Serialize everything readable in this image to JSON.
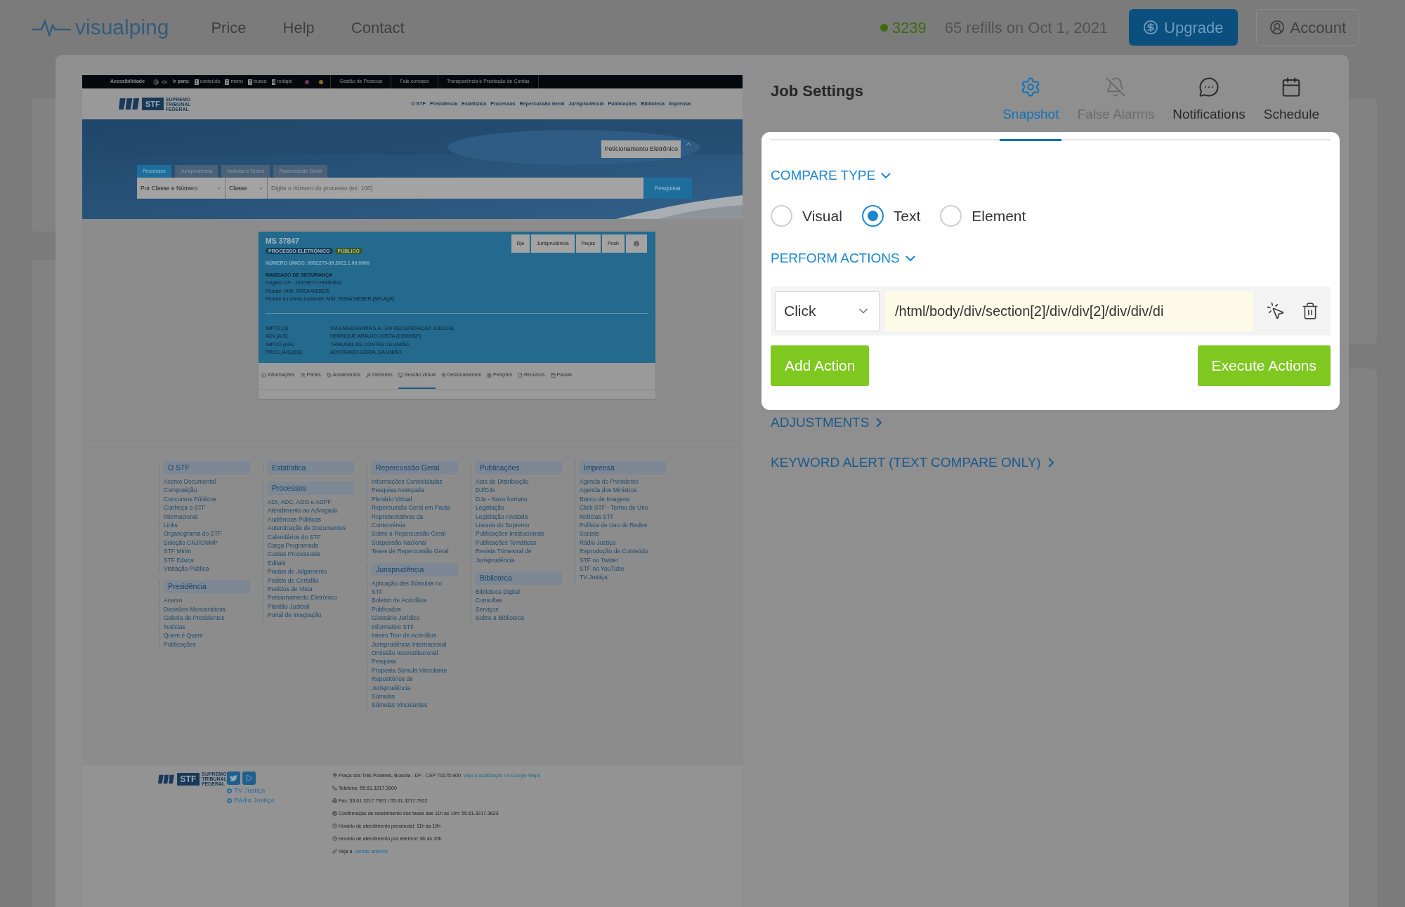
{
  "app_bar": {
    "logo": "visualping",
    "nav": [
      "Price",
      "Help",
      "Contact"
    ],
    "credits": "3239",
    "refills": "65 refills on Oct 1, 2021",
    "upgrade": "Upgrade",
    "account": "Account"
  },
  "preview": {
    "top_bar": {
      "accessibility": "Acessibilidade",
      "goto": "Ir para:",
      "shortcuts": [
        {
          "key": "1",
          "label": "conteúdo"
        },
        {
          "key": "2",
          "label": "menu"
        },
        {
          "key": "3",
          "label": "busca"
        },
        {
          "key": "4",
          "label": "rodapé"
        }
      ],
      "links": [
        "Gestão de Pessoas",
        "Fale conosco",
        "Transparência e Prestação de Contas"
      ]
    },
    "header": {
      "logo_abbr": "STF",
      "logo_name": [
        "SUPREMO",
        "TRIBUNAL",
        "FEDERAL"
      ],
      "nav": [
        "O STF",
        "Presidência",
        "Estatística",
        "Processos",
        "Repercussão Geral",
        "Jurisprudência",
        "Publicações",
        "Biblioteca",
        "Imprensa"
      ]
    },
    "hero": {
      "e_filing": "Peticionamento Eletrônico",
      "tabs": [
        {
          "label": "Processos",
          "selected": true
        },
        {
          "label": "Jurisprudência",
          "selected": false
        },
        {
          "label": "Notícias e Textos",
          "selected": false
        },
        {
          "label": "Repercussão Geral",
          "selected": false
        }
      ],
      "search": {
        "type": "Por Classe e Número",
        "class": "Classe",
        "placeholder": "Digite o número do processo (ex: 100)",
        "button": "Pesquisar"
      }
    },
    "case": {
      "number": "MS 37847",
      "badges": [
        {
          "label": "PROCESSO ELETRÔNICO",
          "color": "#123f5e"
        },
        {
          "label": "PÚBLICO",
          "color": "#3b5a12"
        }
      ],
      "actions": [
        "Dje",
        "Jurisprudência",
        "Peças",
        "Push"
      ],
      "unique_number": "NÚMERO ÚNICO: 0052279-39.2021.1.00.0000",
      "class": "MANDADO DE SEGURANÇA",
      "details": [
        "Origem: DF - DISTRITO FEDERAL",
        "Relator: MIN. ROSA WEBER",
        "Relator do último incidente: MIN. ROSA WEBER (MS-AgR)"
      ],
      "parties": [
        {
          "role": "IMPTE.(S)",
          "name": "VIA ENGENHARIA S.A - EM RECUPERAÇÃO JUDICIAL"
        },
        {
          "role": "ADV.(A/S)",
          "name": "HENRIQUE ARAUJO COSTA (21989/DF)"
        },
        {
          "role": "IMPDO.(A/S)",
          "name": "TRIBUNAL DE CONTAS DA UNIÃO"
        },
        {
          "role": "PROC.(A/S)(ES)",
          "name": "ADVOGADO-GERAL DA UNIÃO"
        }
      ],
      "tabs": [
        {
          "label": "Informações",
          "selected": false
        },
        {
          "label": "Partes",
          "selected": false
        },
        {
          "label": "Andamentos",
          "selected": false
        },
        {
          "label": "Decisões",
          "selected": false
        },
        {
          "label": "Sessão virtual",
          "selected": true
        },
        {
          "label": "Deslocamentos",
          "selected": false
        },
        {
          "label": "Petições",
          "selected": false
        },
        {
          "label": "Recursos",
          "selected": false
        },
        {
          "label": "Pautas",
          "selected": false
        }
      ]
    },
    "sitemap": [
      [
        {
          "title": "O STF",
          "links": [
            "Acervo Documental",
            "Composição",
            "Concursos Públicos",
            "Conheça o STF",
            "Internacional",
            "Links",
            "Organograma do STF",
            "Seleção CNJ/CNMP",
            "STF Mirim",
            "STF Educa",
            "Visitação Pública"
          ]
        },
        {
          "title": "Presidência",
          "links": [
            "Acervo",
            "Decisões Monocráticas",
            "Galeria de Presidentes",
            "Notícias",
            "Quem é Quem",
            "Publicações"
          ]
        }
      ],
      [
        {
          "title": "Estatística"
        },
        {
          "title": "Processos",
          "links": [
            "ADI, ADC, ADO e ADPF",
            "Atendimento ao Advogado",
            "Audiências Públicas",
            "Autenticação de Documentos",
            "Calendários do STF",
            "Carga Programada",
            "Custas Processuais",
            "Editais",
            "Pautas de Julgamento",
            "Pedido de Certidão",
            "Pedidos de Vista",
            "Peticionamento Eletrônico",
            "Plantão Judicial",
            "Portal de Integração"
          ]
        }
      ],
      [
        {
          "title": "Repercussão Geral",
          "links": [
            "Informações Consolidadas",
            "Pesquisa Avançada",
            "Plenário Virtual",
            "Repercussão Geral em Pauta",
            "Representativos da Controvérsia",
            "Sobre a Repercussão Geral",
            "Suspensão Nacional",
            "Teses de Repercussão Geral"
          ]
        },
        {
          "title": "Jurisprudência",
          "links": [
            "Aplicação das Súmulas no STF",
            "Boletim de Acórdãos Publicados",
            "Glossário Jurídico",
            "Informativo STF",
            "Inteiro Teor de Acórdãos",
            "Jurisprudência Internacional",
            "Omissão Inconstitucional",
            "Pesquisa",
            "Proposta Súmula Vinculante",
            "Repositórios de Jurisprudência",
            "Súmulas",
            "Súmulas Vinculantes"
          ]
        }
      ],
      [
        {
          "title": "Publicações",
          "links": [
            "Atas de Distribuição",
            "DJ/DJe",
            "DJe - Novo formato",
            "Legislação",
            "Legislação Anotada",
            "Livraria do Supremo",
            "Publicações Institucionais",
            "Publicações Temáticas",
            "Revista Trimestral de Jurisprudência"
          ]
        },
        {
          "title": "Biblioteca",
          "links": [
            "Biblioteca Digital",
            "Consultas",
            "Serviços",
            "Sobre a Biblioteca"
          ]
        }
      ],
      [
        {
          "title": "Imprensa",
          "links": [
            "Agenda do Presidente",
            "Agenda dos Ministros",
            "Banco de Imagens",
            "Click STF - Termo de Uso",
            "Notícias STF",
            "Política de Uso de Redes Sociais",
            "Rádio Justiça",
            "Reprodução de Conteúdo",
            "STF no Twitter",
            "STF no YouTube",
            "TV Justiça"
          ]
        }
      ]
    ],
    "footer": {
      "logo_abbr": "STF",
      "logo_name": [
        "SUPREMO",
        "TRIBUNAL",
        "FEDERAL"
      ],
      "media": [
        "TV Justiça",
        "Rádio Justiça"
      ],
      "contacts": [
        {
          "text": "Praça dos Três Poderes, Brasília - DF - CEP 70175-900",
          "link": "Veja a localização no Google Maps"
        },
        {
          "text": "Telefone: 55.61.3217.3000"
        },
        {
          "text": "Fax: 55.61.3217.7921 / 55.61.3217.7922"
        },
        {
          "text": "Confirmação de recebimento dos faxes das 11h às 19h: 55.61.3217.3623"
        },
        {
          "text": "Horário de atendimento presencial: 11h às 19h"
        },
        {
          "text": "Horário de atendimento por telefone: 8h às 20h"
        },
        {
          "text": "Veja a",
          "link": "versão anterior"
        }
      ]
    }
  },
  "settings": {
    "title": "Job Settings",
    "tabs": [
      {
        "label": "Snapshot",
        "selected": true,
        "disabled": false
      },
      {
        "label": "False Alarms",
        "selected": false,
        "disabled": true
      },
      {
        "label": "Notifications",
        "selected": false,
        "disabled": false
      },
      {
        "label": "Schedule",
        "selected": false,
        "disabled": false
      }
    ],
    "compare_type": {
      "label": "COMPARE TYPE",
      "expanded": true,
      "options": [
        {
          "label": "Visual",
          "selected": false
        },
        {
          "label": "Text",
          "selected": true
        },
        {
          "label": "Element",
          "selected": false
        }
      ]
    },
    "perform_actions": {
      "label": "PERFORM ACTIONS",
      "expanded": true,
      "actions": [
        {
          "type": "Click",
          "selector": "/html/body/div/section[2]/div/div[2]/div/div/di"
        }
      ],
      "add": "Add Action",
      "execute": "Execute Actions"
    },
    "sections": [
      {
        "label": "ADJUSTMENTS",
        "expanded": false
      },
      {
        "label": "KEYWORD ALERT (TEXT COMPARE ONLY)",
        "expanded": false
      }
    ]
  }
}
